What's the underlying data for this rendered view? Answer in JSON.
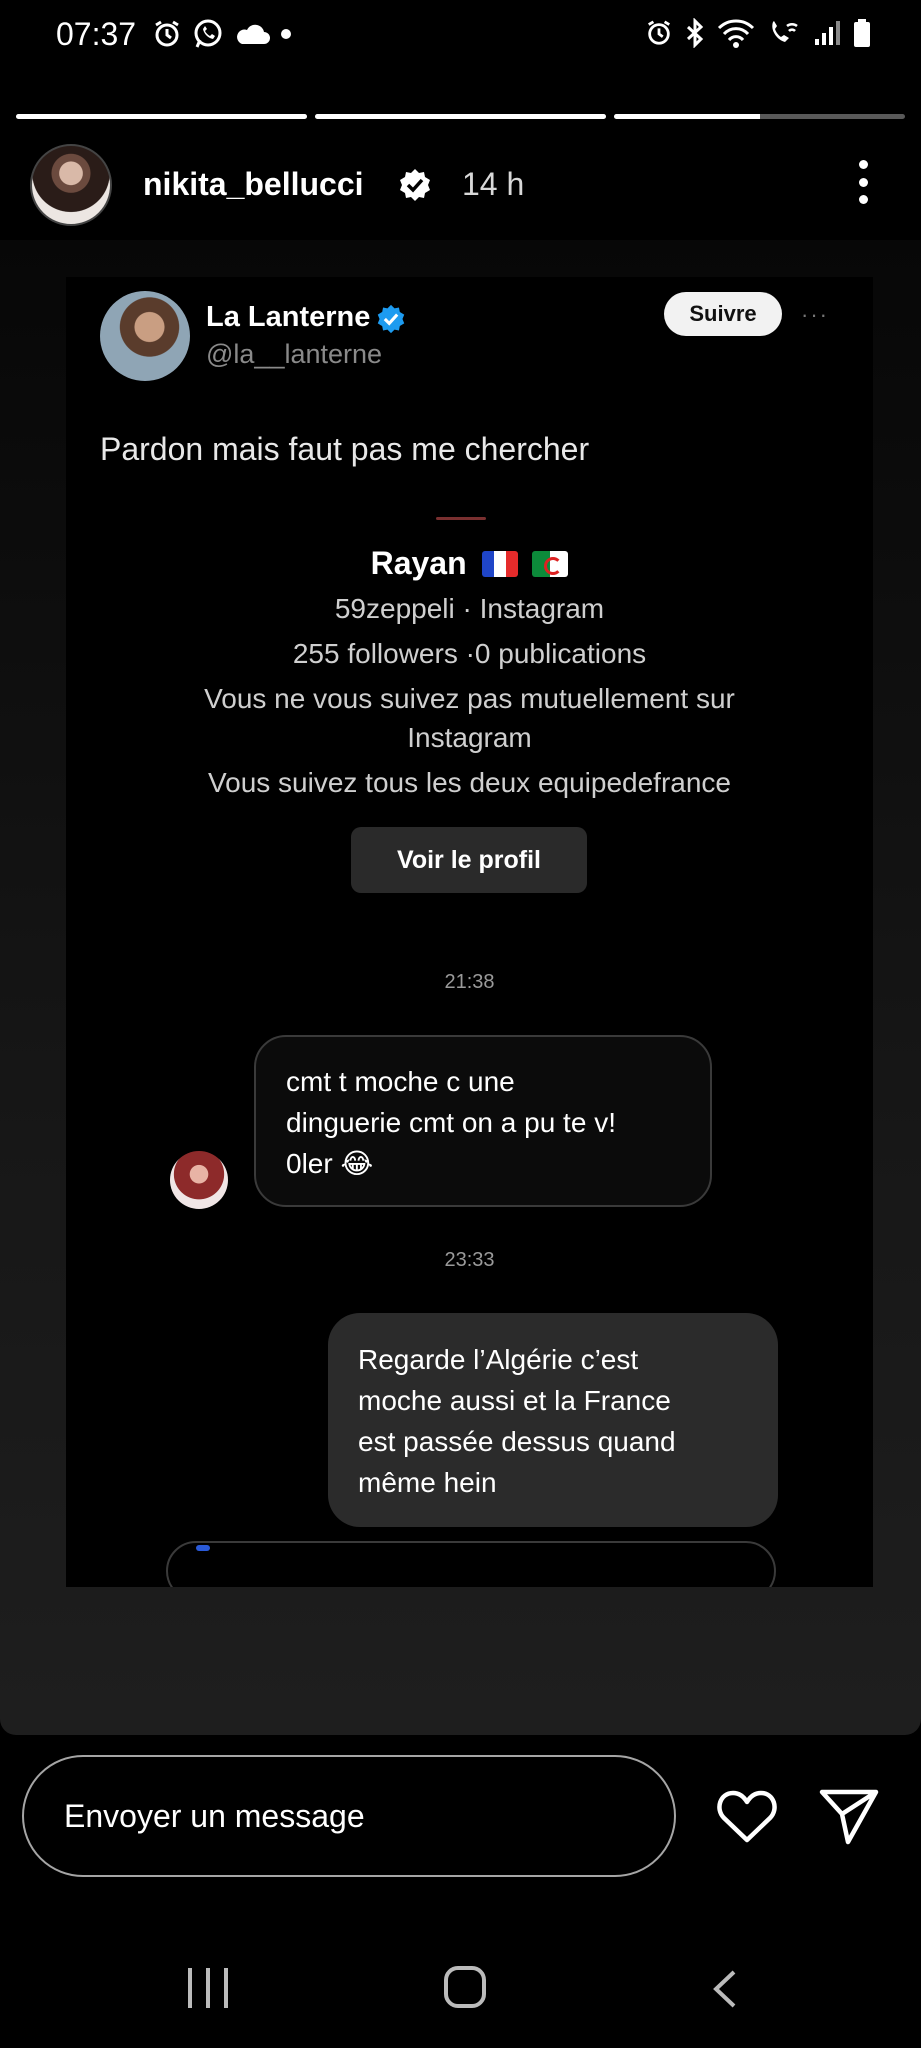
{
  "status_bar": {
    "time": "07:37",
    "left_icons": [
      "alarm-icon",
      "whatsapp-icon",
      "cloud-icon",
      "dot-icon"
    ],
    "right_icons": [
      "alarm-icon",
      "bluetooth-icon",
      "wifi-icon",
      "wifi-calling-icon",
      "signal-icon",
      "battery-icon"
    ]
  },
  "story": {
    "progress": [
      1,
      1,
      0.5
    ],
    "username": "nikita_bellucci",
    "time_ago": "14 h"
  },
  "tweet": {
    "name": "La Lanterne",
    "handle": "@la__lanterne",
    "follow_label": "Suivre",
    "more": "···",
    "text": "Pardon mais faut pas me chercher",
    "accent_color": "#1d9bf0"
  },
  "instagram": {
    "profile_name": "Rayan",
    "flags": [
      "fr-flag",
      "dz-flag"
    ],
    "account_line": "59zeppeli · Instagram",
    "stats_line": "255 followers ·0 publications",
    "mutual_line_1": "Vous ne vous suivez pas mutuellement sur",
    "mutual_line_2": "Instagram",
    "common_line": "Vous suivez tous les deux equipedefrance",
    "view_profile_label": "Voir le profil",
    "timestamp_1": "21:38",
    "timestamp_2": "23:33",
    "incoming_message": [
      "cmt t moche c une",
      "dinguerie cmt on a pu te v!",
      "0ler 😂"
    ],
    "outgoing_message": [
      "Regarde l’Algérie c’est",
      "moche aussi et la France",
      "est passée dessus quand",
      "même hein"
    ]
  },
  "reply_bar": {
    "placeholder": "Envoyer un message"
  },
  "nav": {
    "buttons": [
      "recent-apps",
      "home",
      "back"
    ]
  }
}
